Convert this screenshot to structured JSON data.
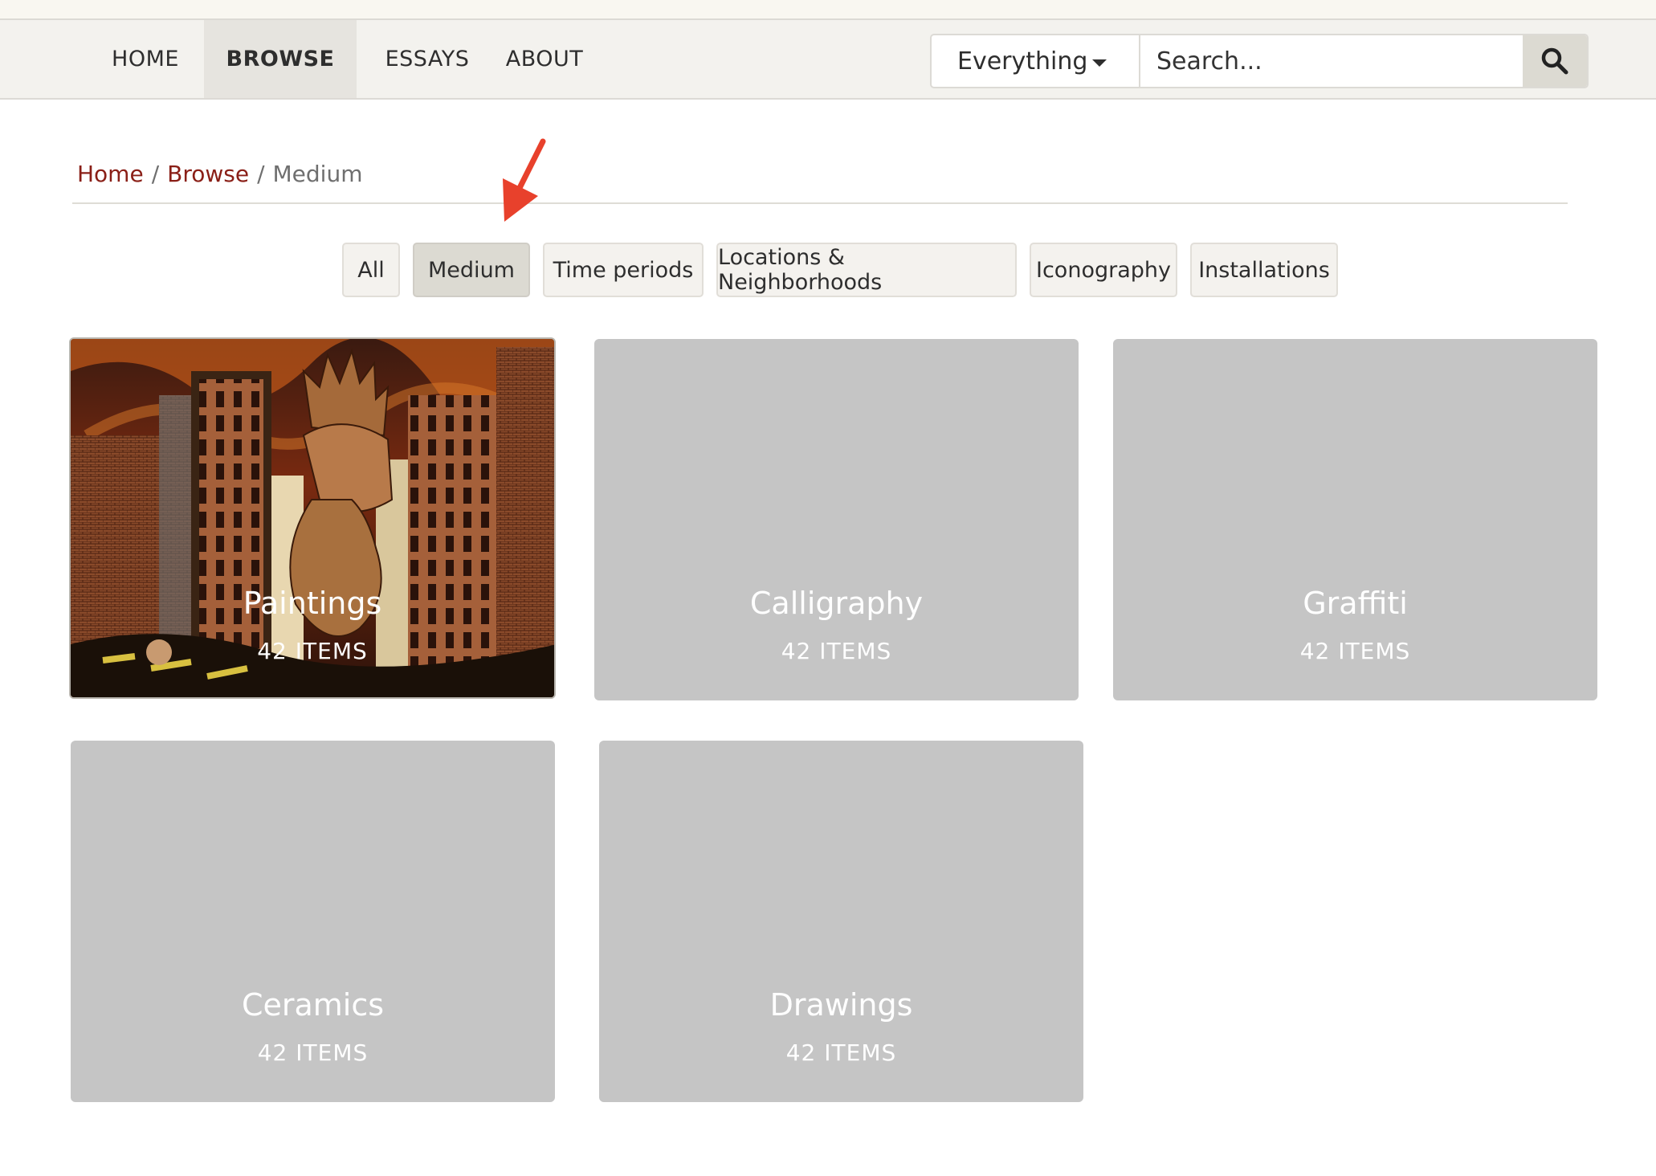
{
  "nav": {
    "items": [
      {
        "label": "HOME"
      },
      {
        "label": "BROWSE",
        "active": true
      },
      {
        "label": "ESSAYS"
      },
      {
        "label": "ABOUT"
      }
    ]
  },
  "search": {
    "scope": "Everything",
    "placeholder": "Search...",
    "button_icon": "search-icon"
  },
  "breadcrumb": {
    "home": "Home",
    "browse": "Browse",
    "current": "Medium",
    "separator": "/"
  },
  "filters": [
    {
      "label": "All"
    },
    {
      "label": "Medium",
      "active": true
    },
    {
      "label": "Time periods"
    },
    {
      "label": "Locations & Neighborhoods"
    },
    {
      "label": "Iconography"
    },
    {
      "label": "Installations"
    }
  ],
  "cards": [
    {
      "title": "Paintings",
      "count": "42 ITEMS",
      "has_image": true
    },
    {
      "title": "Calligraphy",
      "count": "42 ITEMS"
    },
    {
      "title": "Graffiti",
      "count": "42 ITEMS"
    },
    {
      "title": "Ceramics",
      "count": "42 ITEMS"
    },
    {
      "title": "Drawings",
      "count": "42 ITEMS"
    }
  ],
  "colors": {
    "link": "#8a1f17",
    "card_placeholder": "#c5c5c5",
    "annotation_arrow": "#e8412c"
  }
}
